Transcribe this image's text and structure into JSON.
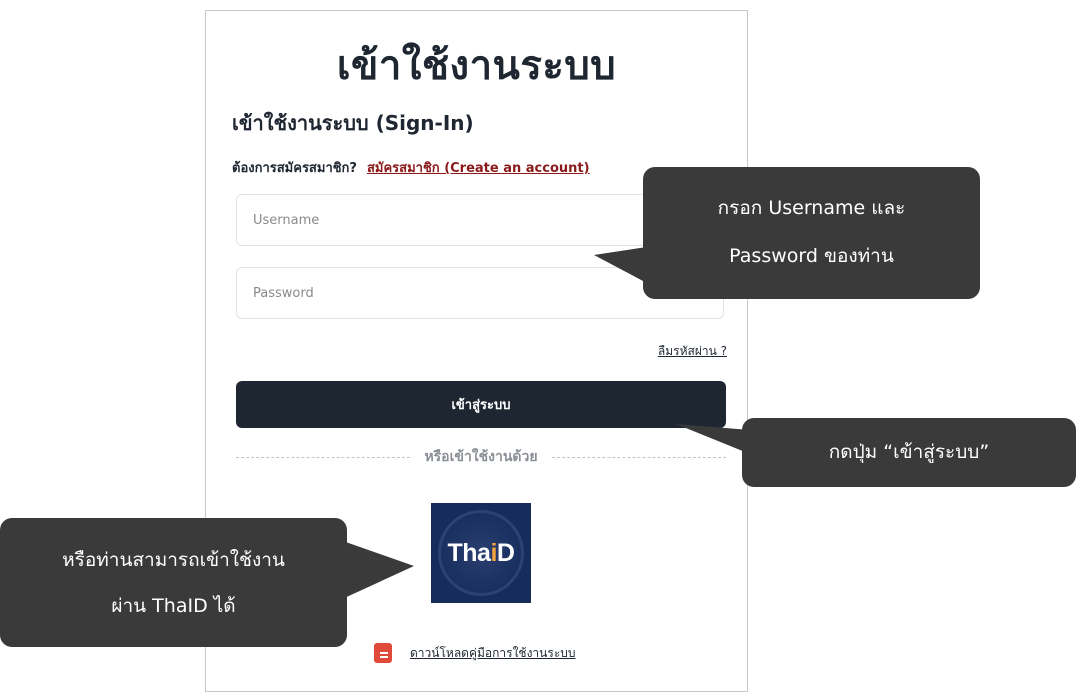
{
  "page": {
    "title": "เข้าใช้งานระบบ",
    "subtitle": "เข้าใช้งานระบบ (Sign-In)"
  },
  "register": {
    "prompt": "ต้องการสมัครสมาชิก?",
    "link": "สมัครสมาชิก (Create an account)"
  },
  "form": {
    "username_placeholder": "Username",
    "username_value": "",
    "password_placeholder": "Password",
    "password_value": "",
    "forgot_password": "ลืมรหัสผ่าน ?",
    "login_button": "เข้าสู่ระบบ"
  },
  "alt_login": {
    "divider_label": "หรือเข้าใช้งานด้วย",
    "thaid_logo_text": "ThaiD",
    "thaid_icon": "thaid-logo-icon"
  },
  "download": {
    "label": "ดาวน์โหลดคู่มือการใช้งานระบบ",
    "icon": "pdf-icon",
    "icon_color": "#e04a3b"
  },
  "callouts": {
    "credentials": [
      "กรอก Username และ",
      "Password ของท่าน"
    ],
    "login_button": "กดปุ่ม “เข้าสู่ระบบ”",
    "thaid": [
      "หรือท่านสามารถเข้าใช้งาน",
      "ผ่าน ThaID ได้"
    ]
  },
  "colors": {
    "primary_dark": "#1e2631",
    "link_red": "#8b1a1a",
    "callout_bg": "#3a3a3a",
    "thaid_bg": "#162c5a",
    "thaid_accent": "#f2a23a"
  }
}
